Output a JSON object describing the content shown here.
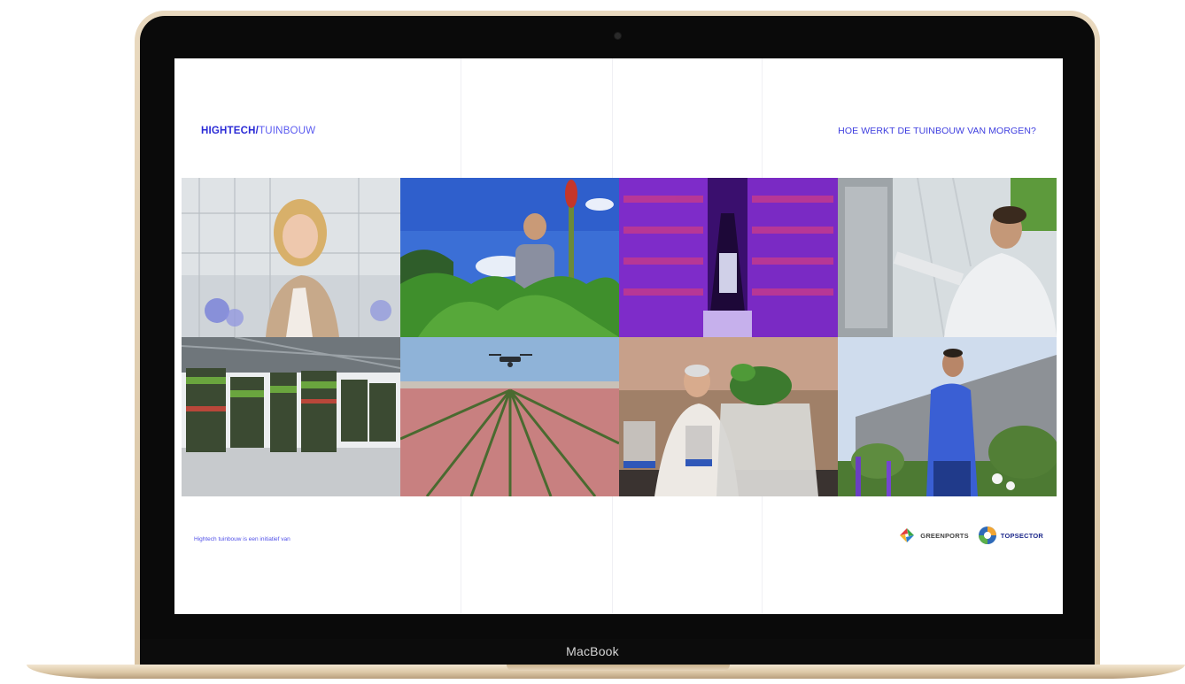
{
  "device": {
    "brand_label": "MacBook"
  },
  "header": {
    "logo_bold": "HIGHTECH/",
    "logo_light": "TUINBOUW",
    "headline": "HOE WERKT DE TUINBOUW VAN MORGEN?"
  },
  "photos": [
    {
      "subject": "woman-in-greenhouse"
    },
    {
      "subject": "man-in-field"
    },
    {
      "subject": "vertical-farm-purple-light"
    },
    {
      "subject": "technician-greenhouse"
    },
    {
      "subject": "plant-trolleys-warehouse"
    },
    {
      "subject": "drone-over-flower-field"
    },
    {
      "subject": "researcher-lab-plants"
    },
    {
      "subject": "man-outside-building"
    }
  ],
  "footer": {
    "note": "Hightech tuinbouw is een initiatief van",
    "partners": [
      {
        "name": "GREENPORTS"
      },
      {
        "name": "TOPSECTOR"
      }
    ]
  },
  "colors": {
    "accent": "#2b2bd6",
    "lid": "#dcc7a6",
    "bezel": "#0a0a0a"
  }
}
